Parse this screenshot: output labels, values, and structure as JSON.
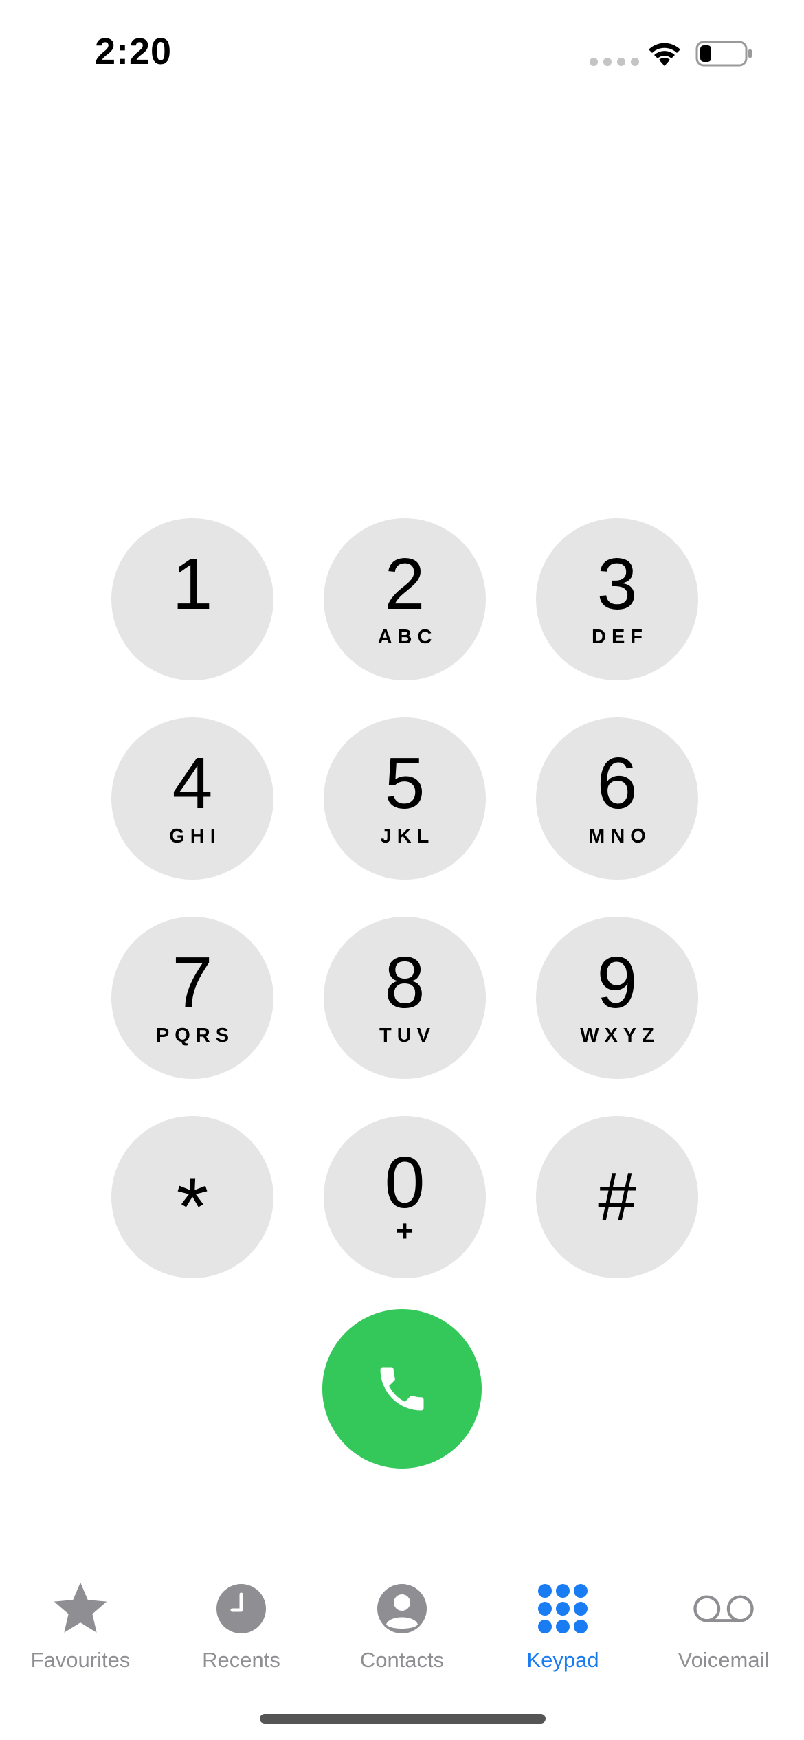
{
  "status_bar": {
    "time": "2:20"
  },
  "keypad": {
    "keys": [
      {
        "digit": "1",
        "letters": ""
      },
      {
        "digit": "2",
        "letters": "ABC"
      },
      {
        "digit": "3",
        "letters": "DEF"
      },
      {
        "digit": "4",
        "letters": "GHI"
      },
      {
        "digit": "5",
        "letters": "JKL"
      },
      {
        "digit": "6",
        "letters": "MNO"
      },
      {
        "digit": "7",
        "letters": "PQRS"
      },
      {
        "digit": "8",
        "letters": "TUV"
      },
      {
        "digit": "9",
        "letters": "WXYZ"
      },
      {
        "digit": "*",
        "letters": ""
      },
      {
        "digit": "0",
        "letters": "+"
      },
      {
        "digit": "#",
        "letters": ""
      }
    ],
    "call_icon": "phone-icon",
    "call_color": "#34c759",
    "key_color": "#e5e5e5"
  },
  "tab_bar": {
    "active_color": "#1a7cf3",
    "inactive_color": "#8e8e93",
    "tabs": [
      {
        "label": "Favourites",
        "icon": "star-icon",
        "active": false
      },
      {
        "label": "Recents",
        "icon": "clock-icon",
        "active": false
      },
      {
        "label": "Contacts",
        "icon": "person-icon",
        "active": false
      },
      {
        "label": "Keypad",
        "icon": "keypad-icon",
        "active": true
      },
      {
        "label": "Voicemail",
        "icon": "voicemail-icon",
        "active": false
      }
    ]
  }
}
